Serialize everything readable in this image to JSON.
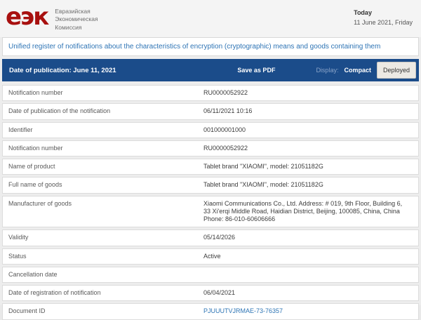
{
  "header": {
    "logo_mark": "еэк",
    "logo_line1": "Евразийская",
    "logo_line2": "Экономическая",
    "logo_line3": "Комиссия",
    "today_label": "Today",
    "today_date": "11 June 2021, Friday"
  },
  "title": "Unified register of notifications about the characteristics of encryption (cryptographic) means and goods containing them",
  "toolbar": {
    "publication_date": "Date of publication: June 11, 2021",
    "save_as_pdf": "Save as PDF",
    "display_label": "Display:",
    "compact": "Compact",
    "deployed": "Deployed"
  },
  "colors": {
    "logo_red": "#a8100f",
    "toolbar_blue": "#1b4c8a",
    "title_blue": "#2e74b5",
    "link_blue": "#2e75b5"
  },
  "table": {
    "rows": [
      {
        "label": "Notification number",
        "value": "RU0000052922"
      },
      {
        "label": "Date of publication of the notification",
        "value": "06/11/2021 10:16"
      },
      {
        "label": "Identifier",
        "value": "001000001000"
      },
      {
        "label": "Notification number",
        "value": "RU0000052922"
      },
      {
        "label": "Name of product",
        "value": "Tablet brand \"XIAOMI\", model: 21051182G"
      },
      {
        "label": "Full name of goods",
        "value": "Tablet brand \"XIAOMI\", model: 21051182G"
      },
      {
        "label": "Manufacturer of goods",
        "value": "Xiaomi Communications Co., Ltd. Address: # 019, 9th Floor, Building 6, 33 Xi'erqi Middle Road, Haidian District, Beijing, 100085, China, China Phone: 86-010-60606666"
      },
      {
        "label": "Validity",
        "value": "05/14/2026"
      },
      {
        "label": "Status",
        "value": "Active"
      },
      {
        "label": "Cancellation date",
        "value": ""
      },
      {
        "label": "Date of registration of notification",
        "value": "06/04/2021"
      },
      {
        "label": "Document ID",
        "value": "PJUUUTVJRMAE-73-76357"
      }
    ]
  }
}
